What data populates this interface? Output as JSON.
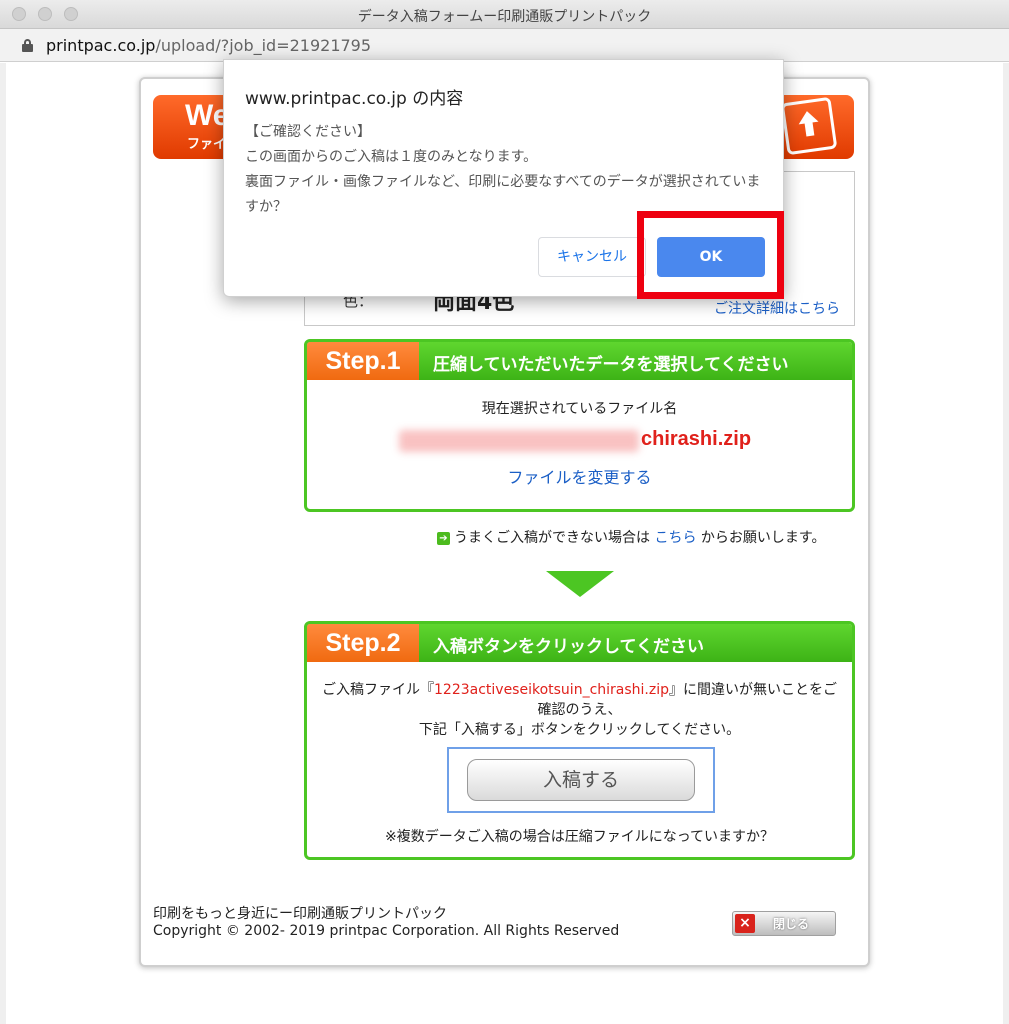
{
  "window": {
    "title": "データ入稿フォームー印刷通販プリントパック",
    "url_host": "printpac.co.jp",
    "url_path": "/upload/?job_id=21921795"
  },
  "header": {
    "banner_text": "We",
    "banner_sub": "ファイ"
  },
  "order": {
    "color_label": "色：",
    "color_value": "両面4色",
    "detail_link": "ご注文詳細はこちら"
  },
  "step1": {
    "badge": "Step.1",
    "title": "圧縮していただいたデータを選択してください",
    "selected_label": "現在選択されているファイル名",
    "filename_suffix": "chirashi.zip",
    "change_link": "ファイルを変更する"
  },
  "help": {
    "prefix": "うまくご入稿ができない場合は",
    "link": "こちら",
    "suffix": "からお願いします。"
  },
  "step2": {
    "badge": "Step.2",
    "title": "入稿ボタンをクリックしてください",
    "text_before": "ご入稿ファイル『",
    "filename": "1223activeseikotsuin_chirashi.zip",
    "text_after": "』に間違いが無いことをご確認のうえ、",
    "text_line3": "下記「入稿する」ボタンをクリックしてください。",
    "submit_label": "入稿する",
    "note": "※複数データご入稿の場合は圧縮ファイルになっていますか？"
  },
  "footer": {
    "tagline": "印刷をもっと身近にー印刷通販プリントパック",
    "copyright": "Copyright © 2002- 2019 printpac Corporation. All Rights Reserved",
    "close_label": "閉じる",
    "close_icon_glyph": "×"
  },
  "dialog": {
    "title": "www.printpac.co.jp の内容",
    "line1": "【ご確認ください】",
    "line2": "この画面からのご入稿は１度のみとなります。",
    "line3": "裏面ファイル・画像ファイルなど、印刷に必要なすべてのデータが選択されていますか？",
    "cancel_label": "キャンセル",
    "ok_label": "OK"
  },
  "colors": {
    "green": "#4cc623",
    "orange": "#f06a10",
    "link_blue": "#1b5fc6",
    "red_text": "#e0211b",
    "ok_blue": "#4a88ee",
    "highlight_red": "#ee0010"
  }
}
